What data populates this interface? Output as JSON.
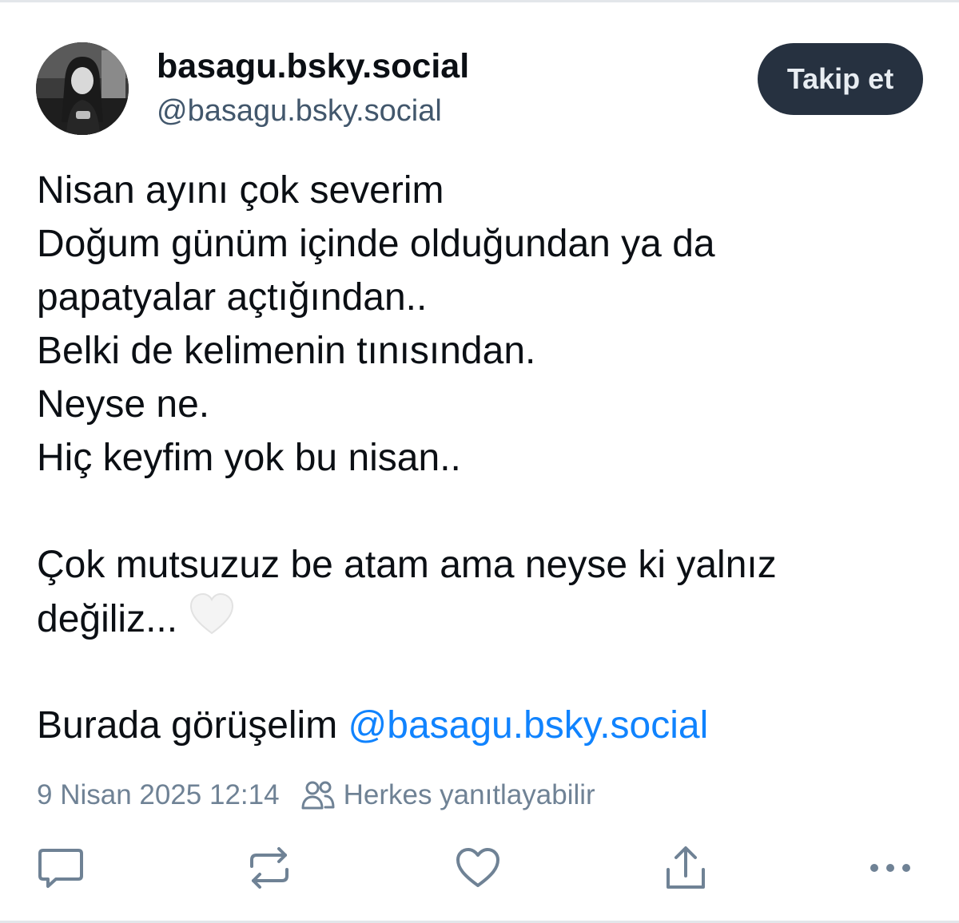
{
  "post": {
    "author": {
      "display_name": "basagu.bsky.social",
      "handle": "@basagu.bsky.social"
    },
    "follow_label": "Takip et",
    "lines": [
      "Nisan ayını çok severim",
      "Doğum günüm içinde olduğundan ya da",
      "papatyalar açtığından..",
      "Belki de kelimenin tınısından.",
      "Neyse ne.",
      "Hiç keyfim yok bu nisan..",
      "",
      "Çok mutsuzuz be atam ama neyse ki yalnız",
      "değiliz..."
    ],
    "closing_text": "Burada görüşelim ",
    "mention": "@basagu.bsky.social",
    "timestamp": "9 Nisan 2025 12:14",
    "reply_setting": "Herkes yanıtlayabilir"
  },
  "icons": {
    "heart_emoji": "white-heart-icon",
    "reply": "comment-icon",
    "repost": "repost-icon",
    "like": "heart-icon",
    "share": "share-icon",
    "more": "more-icon",
    "people": "people-icon"
  },
  "colors": {
    "follow_button_bg": "#263140",
    "link": "#1083fe",
    "muted": "#6f8295",
    "handle": "#42576c"
  }
}
